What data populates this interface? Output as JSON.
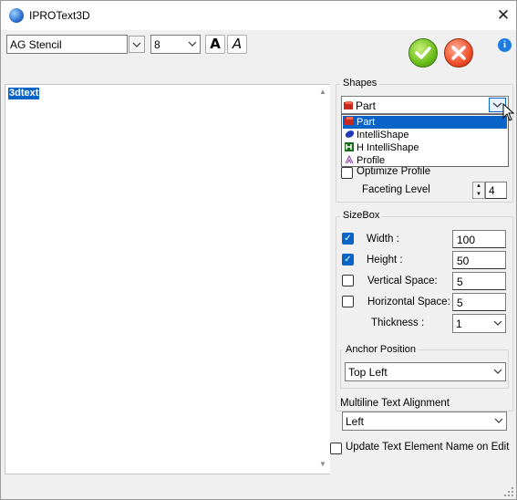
{
  "window": {
    "title": "IPROText3D",
    "close_glyph": "✕"
  },
  "toolbar": {
    "font_name": "AG Stencil",
    "font_size": "8",
    "bold_label": "A",
    "italic_label": "A",
    "info_label": "i"
  },
  "editor": {
    "text": "3dtext"
  },
  "shapes": {
    "title": "Shapes",
    "selected": "Part",
    "options": [
      {
        "label": "Part",
        "icon": "part-icon"
      },
      {
        "label": "IntelliShape",
        "icon": "intellishape-icon"
      },
      {
        "label": "H IntelliShape",
        "icon": "h-intellishape-icon"
      },
      {
        "label": "Profile",
        "icon": "profile-icon"
      }
    ],
    "optimize_profile_label": "Optimize Profile",
    "optimize_profile_checked": false,
    "faceting_level_label": "Faceting Level",
    "faceting_level_value": "4"
  },
  "sizebox": {
    "title": "SizeBox",
    "width_label": "Width :",
    "width_checked": true,
    "width_value": "100",
    "height_label": "Height :",
    "height_checked": true,
    "height_value": "50",
    "vspace_label": "Vertical Space:",
    "vspace_checked": false,
    "vspace_value": "5",
    "hspace_label": "Horizontal Space:",
    "hspace_checked": false,
    "hspace_value": "5",
    "thickness_label": "Thickness :",
    "thickness_value": "1"
  },
  "anchor": {
    "title": "Anchor Position",
    "value": "Top Left"
  },
  "alignment": {
    "title": "Multiline Text Alignment",
    "value": "Left"
  },
  "update_name": {
    "label": "Update Text Element Name on Edit",
    "checked": false
  },
  "colors": {
    "selection": "#0a64c8",
    "ok": "#6cbd1a",
    "cancel": "#f0502a",
    "info": "#1e7be0"
  }
}
